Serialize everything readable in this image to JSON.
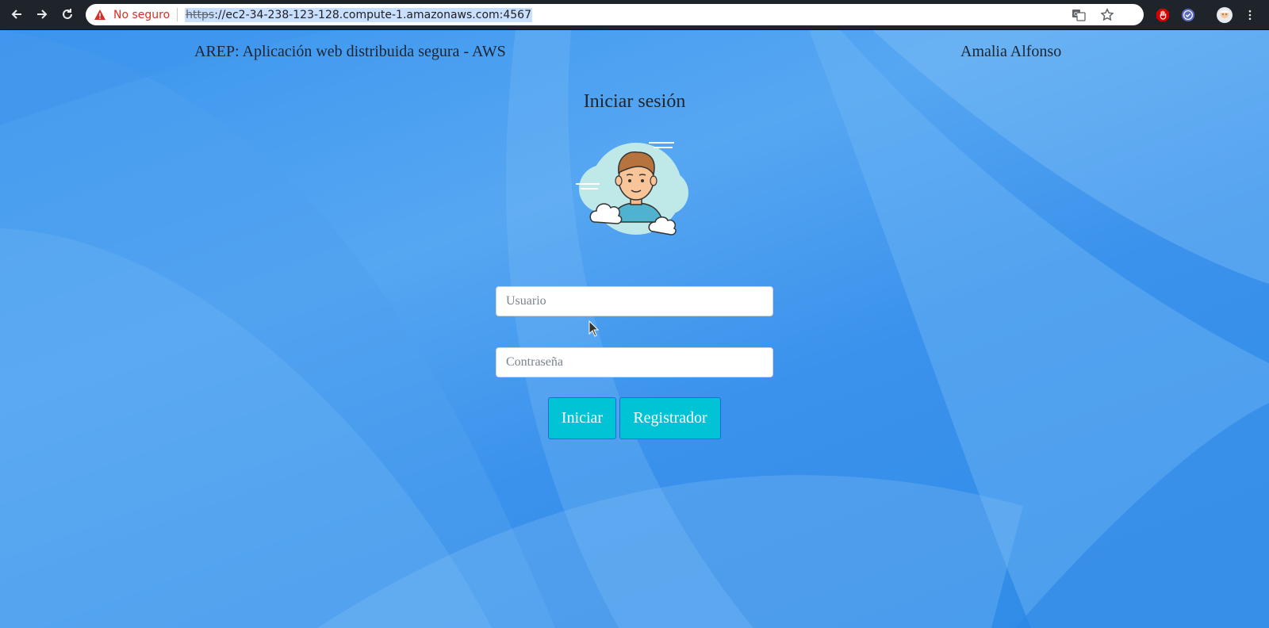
{
  "browser": {
    "security_label": "No seguro",
    "url_scheme": "https",
    "url_rest": "://ec2-34-238-123-128.compute-1.amazonaws.com:4567"
  },
  "header": {
    "app_title": "AREP: Aplicación web distribuida segura - AWS",
    "author": "Amalia Alfonso"
  },
  "login": {
    "title": "Iniciar sesión",
    "username_placeholder": "Usuario",
    "username_value": "",
    "password_placeholder": "Contraseña",
    "password_value": "",
    "login_button": "Iniciar",
    "register_button": "Registrador"
  },
  "colors": {
    "button_bg": "#00c4d6",
    "insecure": "#d93025"
  }
}
